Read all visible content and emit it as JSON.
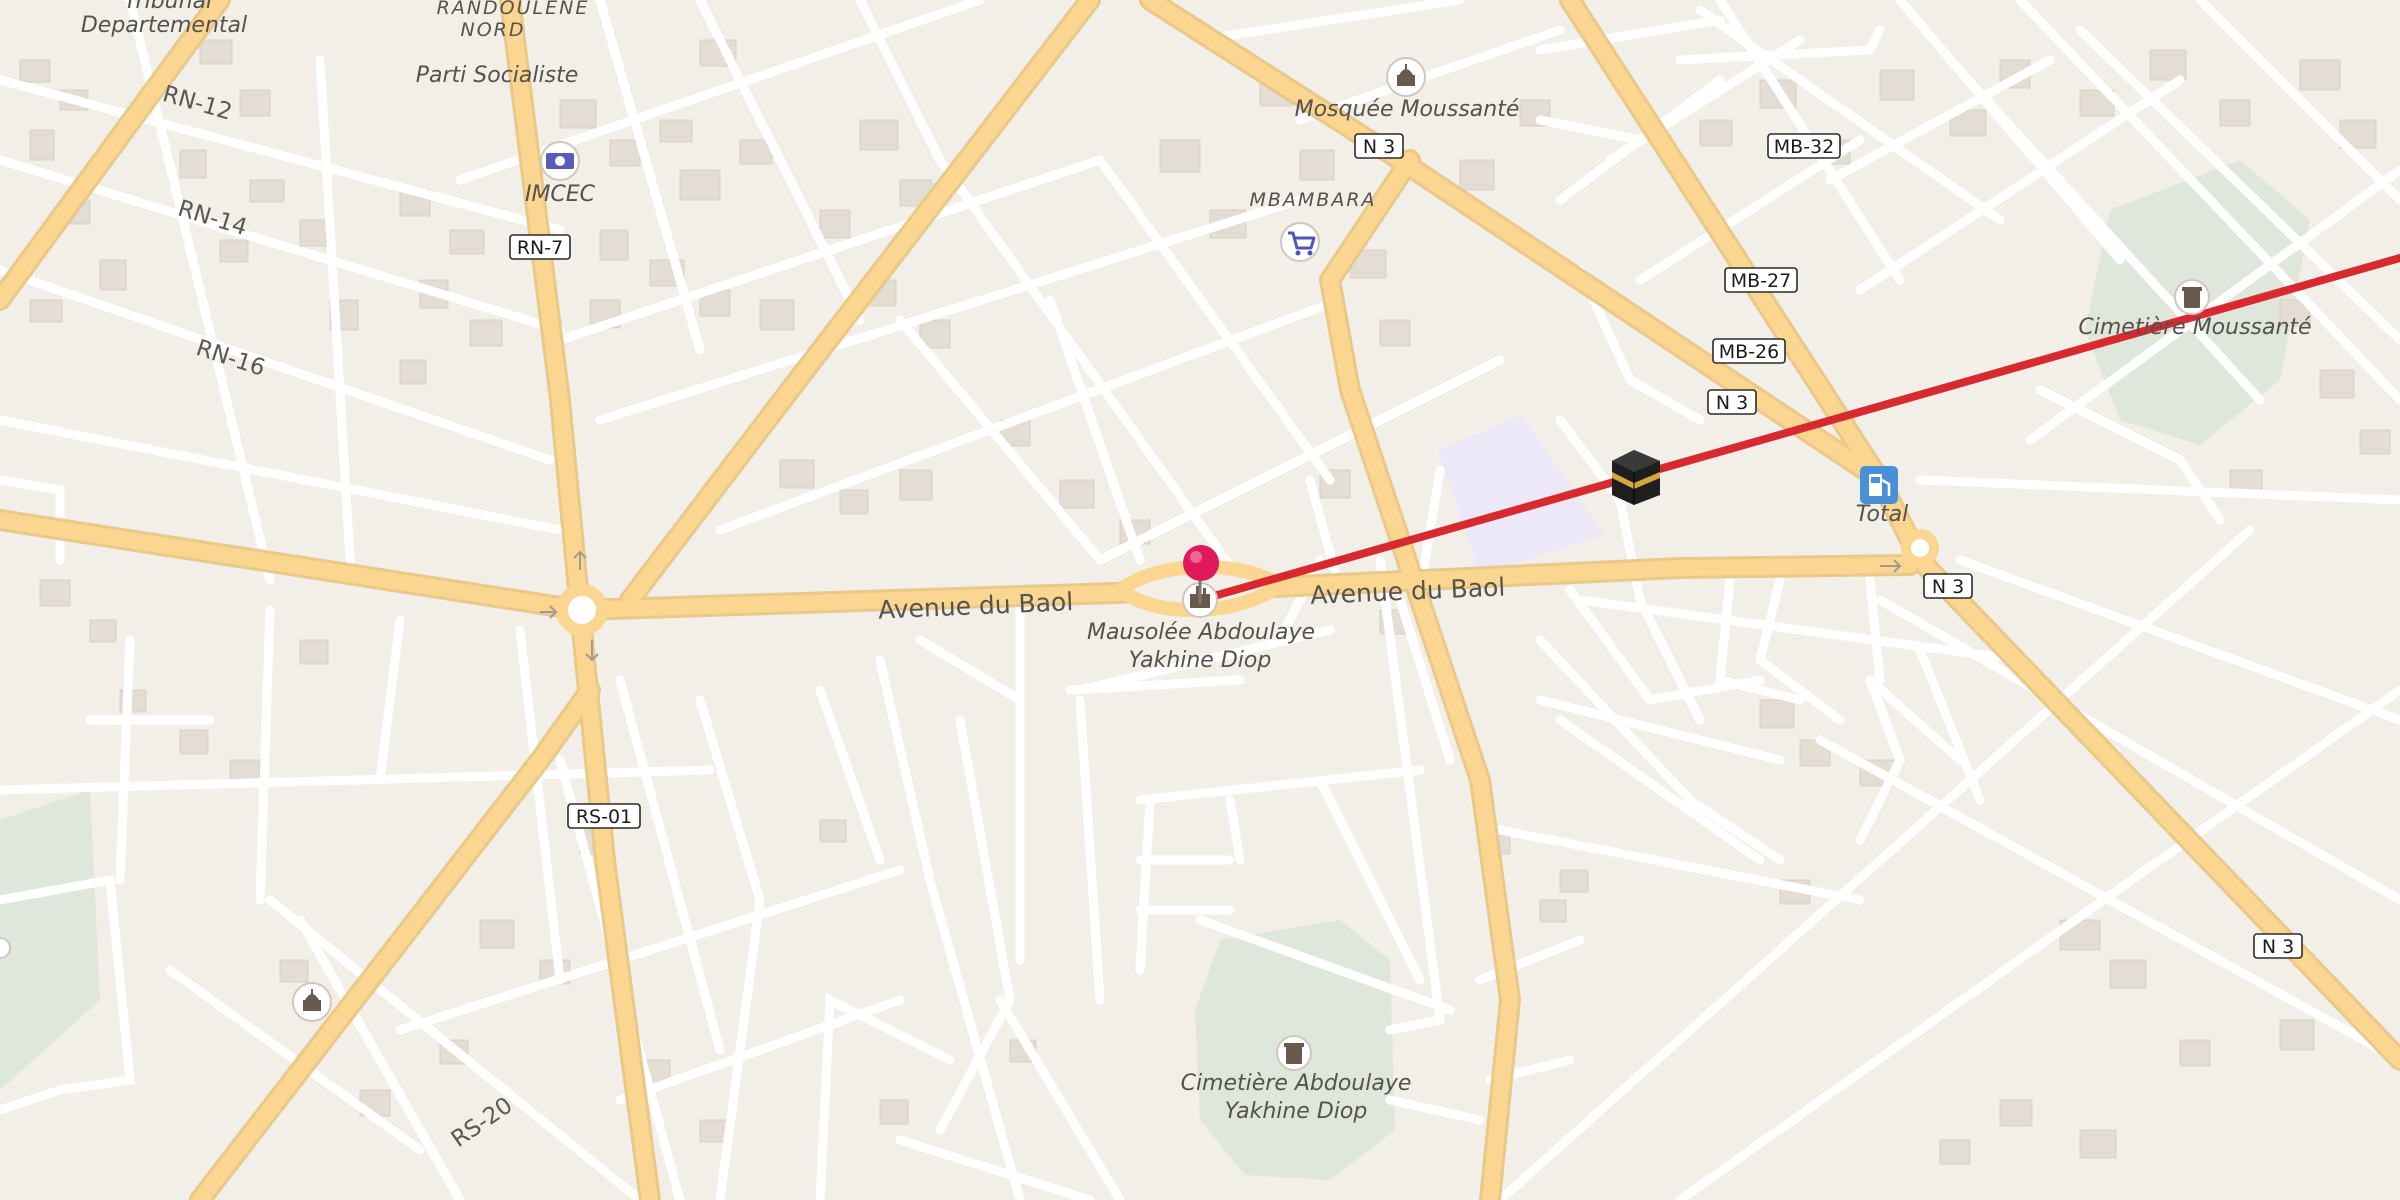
{
  "map": {
    "route_color": "#d8292f",
    "pin_color": "#e0195c",
    "mosque_marker": "kaaba-icon",
    "fuel_color": "#4a90d9"
  },
  "labels": {
    "district_randoulene": "RANDOULENE",
    "district_nord": "NORD",
    "tribunal": "Tribunal",
    "departemental": "Departemental",
    "parti_socialiste": "Parti Socialiste",
    "imcec": "IMCEC",
    "mosquee": "Mosquée Moussanté",
    "mbambara": "MBAMBARA",
    "mausolee_line1": "Mausolée Abdoulaye",
    "mausolee_line2": "Yakhine Diop",
    "cimetiere_moussante": "Cimetière Moussanté",
    "cimetiere_ab_line1": "Cimetière Abdoulaye",
    "cimetiere_ab_line2": "Yakhine Diop",
    "total": "Total",
    "avenue_west": "Avenue du Baol",
    "avenue_east": "Avenue du Baol",
    "rn12": "RN-12",
    "rn14": "RN-14",
    "rn16": "RN-16",
    "rs20": "RS-20"
  },
  "shields": {
    "rn7": "RN-7",
    "rs01": "RS-01",
    "n3_top": "N 3",
    "n3_mid": "N 3",
    "n3_right": "N 3",
    "n3_bottom": "N 3",
    "mb32": "MB-32",
    "mb27": "MB-27",
    "mb26": "MB-26"
  }
}
